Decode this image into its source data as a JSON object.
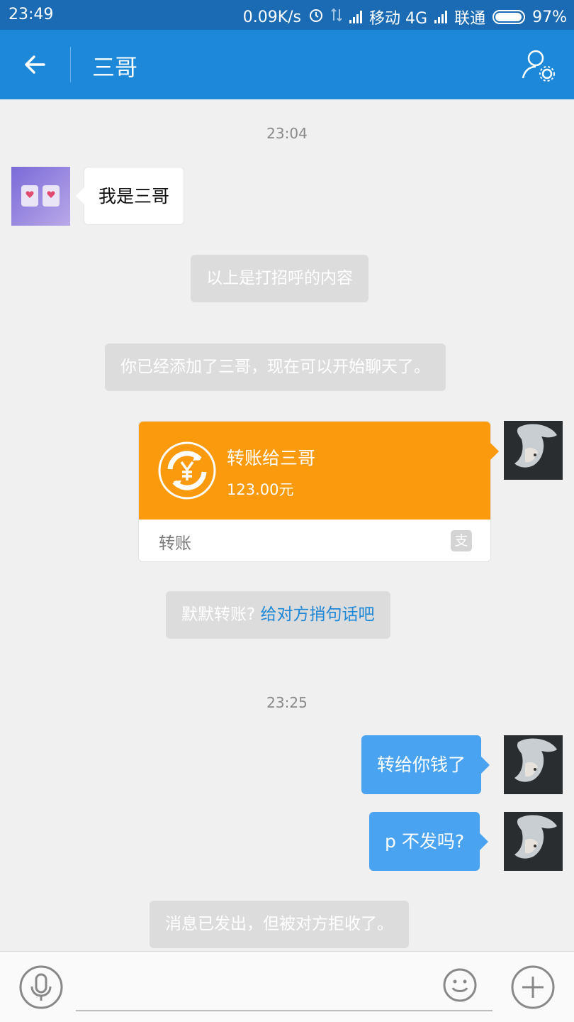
{
  "status_bar": {
    "time": "23:49",
    "speed": "0.09K/s",
    "carrier1": "移动 4G",
    "carrier2": "联通",
    "battery": "97%",
    "battery_level": 0.97
  },
  "header": {
    "title": "三哥",
    "icons": [
      "back-arrow-icon",
      "profile-settings-icon"
    ]
  },
  "chat": {
    "timestamp1": "23:04",
    "msg_in_1": "我是三哥",
    "sys_1": "以上是打招呼的内容",
    "sys_2": "你已经添加了三哥，现在可以开始聊天了。",
    "transfer": {
      "title": "转账给三哥",
      "amount": "123.00元",
      "label": "转账",
      "badge": "支"
    },
    "sys_3_text": "默默转账?",
    "sys_3_link": "给对方捎句话吧",
    "timestamp2": "23:25",
    "msg_out_1": "转给你钱了",
    "msg_out_2": "p 不发吗?",
    "sys_4": "消息已发出，但被对方拒收了。"
  },
  "input_bar": {
    "placeholder": "",
    "icons": [
      "microphone-icon",
      "emoji-icon",
      "plus-icon"
    ]
  },
  "colors": {
    "status_bar": "#1a6bb3",
    "nav_bar": "#1d87d8",
    "bubble_out": "#4aa3f0",
    "transfer_orange": "#fa9a0c",
    "system_bubble": "#dcdcdc"
  }
}
